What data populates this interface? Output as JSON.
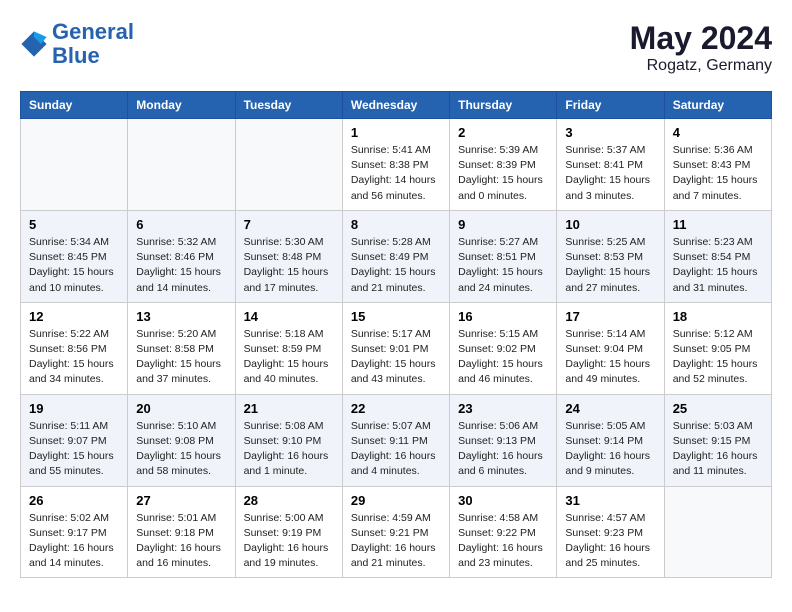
{
  "logo": {
    "line1": "General",
    "line2": "Blue"
  },
  "title": "May 2024",
  "subtitle": "Rogatz, Germany",
  "days_of_week": [
    "Sunday",
    "Monday",
    "Tuesday",
    "Wednesday",
    "Thursday",
    "Friday",
    "Saturday"
  ],
  "weeks": [
    [
      {
        "num": "",
        "info": ""
      },
      {
        "num": "",
        "info": ""
      },
      {
        "num": "",
        "info": ""
      },
      {
        "num": "1",
        "info": "Sunrise: 5:41 AM\nSunset: 8:38 PM\nDaylight: 14 hours\nand 56 minutes."
      },
      {
        "num": "2",
        "info": "Sunrise: 5:39 AM\nSunset: 8:39 PM\nDaylight: 15 hours\nand 0 minutes."
      },
      {
        "num": "3",
        "info": "Sunrise: 5:37 AM\nSunset: 8:41 PM\nDaylight: 15 hours\nand 3 minutes."
      },
      {
        "num": "4",
        "info": "Sunrise: 5:36 AM\nSunset: 8:43 PM\nDaylight: 15 hours\nand 7 minutes."
      }
    ],
    [
      {
        "num": "5",
        "info": "Sunrise: 5:34 AM\nSunset: 8:45 PM\nDaylight: 15 hours\nand 10 minutes."
      },
      {
        "num": "6",
        "info": "Sunrise: 5:32 AM\nSunset: 8:46 PM\nDaylight: 15 hours\nand 14 minutes."
      },
      {
        "num": "7",
        "info": "Sunrise: 5:30 AM\nSunset: 8:48 PM\nDaylight: 15 hours\nand 17 minutes."
      },
      {
        "num": "8",
        "info": "Sunrise: 5:28 AM\nSunset: 8:49 PM\nDaylight: 15 hours\nand 21 minutes."
      },
      {
        "num": "9",
        "info": "Sunrise: 5:27 AM\nSunset: 8:51 PM\nDaylight: 15 hours\nand 24 minutes."
      },
      {
        "num": "10",
        "info": "Sunrise: 5:25 AM\nSunset: 8:53 PM\nDaylight: 15 hours\nand 27 minutes."
      },
      {
        "num": "11",
        "info": "Sunrise: 5:23 AM\nSunset: 8:54 PM\nDaylight: 15 hours\nand 31 minutes."
      }
    ],
    [
      {
        "num": "12",
        "info": "Sunrise: 5:22 AM\nSunset: 8:56 PM\nDaylight: 15 hours\nand 34 minutes."
      },
      {
        "num": "13",
        "info": "Sunrise: 5:20 AM\nSunset: 8:58 PM\nDaylight: 15 hours\nand 37 minutes."
      },
      {
        "num": "14",
        "info": "Sunrise: 5:18 AM\nSunset: 8:59 PM\nDaylight: 15 hours\nand 40 minutes."
      },
      {
        "num": "15",
        "info": "Sunrise: 5:17 AM\nSunset: 9:01 PM\nDaylight: 15 hours\nand 43 minutes."
      },
      {
        "num": "16",
        "info": "Sunrise: 5:15 AM\nSunset: 9:02 PM\nDaylight: 15 hours\nand 46 minutes."
      },
      {
        "num": "17",
        "info": "Sunrise: 5:14 AM\nSunset: 9:04 PM\nDaylight: 15 hours\nand 49 minutes."
      },
      {
        "num": "18",
        "info": "Sunrise: 5:12 AM\nSunset: 9:05 PM\nDaylight: 15 hours\nand 52 minutes."
      }
    ],
    [
      {
        "num": "19",
        "info": "Sunrise: 5:11 AM\nSunset: 9:07 PM\nDaylight: 15 hours\nand 55 minutes."
      },
      {
        "num": "20",
        "info": "Sunrise: 5:10 AM\nSunset: 9:08 PM\nDaylight: 15 hours\nand 58 minutes."
      },
      {
        "num": "21",
        "info": "Sunrise: 5:08 AM\nSunset: 9:10 PM\nDaylight: 16 hours\nand 1 minute."
      },
      {
        "num": "22",
        "info": "Sunrise: 5:07 AM\nSunset: 9:11 PM\nDaylight: 16 hours\nand 4 minutes."
      },
      {
        "num": "23",
        "info": "Sunrise: 5:06 AM\nSunset: 9:13 PM\nDaylight: 16 hours\nand 6 minutes."
      },
      {
        "num": "24",
        "info": "Sunrise: 5:05 AM\nSunset: 9:14 PM\nDaylight: 16 hours\nand 9 minutes."
      },
      {
        "num": "25",
        "info": "Sunrise: 5:03 AM\nSunset: 9:15 PM\nDaylight: 16 hours\nand 11 minutes."
      }
    ],
    [
      {
        "num": "26",
        "info": "Sunrise: 5:02 AM\nSunset: 9:17 PM\nDaylight: 16 hours\nand 14 minutes."
      },
      {
        "num": "27",
        "info": "Sunrise: 5:01 AM\nSunset: 9:18 PM\nDaylight: 16 hours\nand 16 minutes."
      },
      {
        "num": "28",
        "info": "Sunrise: 5:00 AM\nSunset: 9:19 PM\nDaylight: 16 hours\nand 19 minutes."
      },
      {
        "num": "29",
        "info": "Sunrise: 4:59 AM\nSunset: 9:21 PM\nDaylight: 16 hours\nand 21 minutes."
      },
      {
        "num": "30",
        "info": "Sunrise: 4:58 AM\nSunset: 9:22 PM\nDaylight: 16 hours\nand 23 minutes."
      },
      {
        "num": "31",
        "info": "Sunrise: 4:57 AM\nSunset: 9:23 PM\nDaylight: 16 hours\nand 25 minutes."
      },
      {
        "num": "",
        "info": ""
      }
    ]
  ]
}
